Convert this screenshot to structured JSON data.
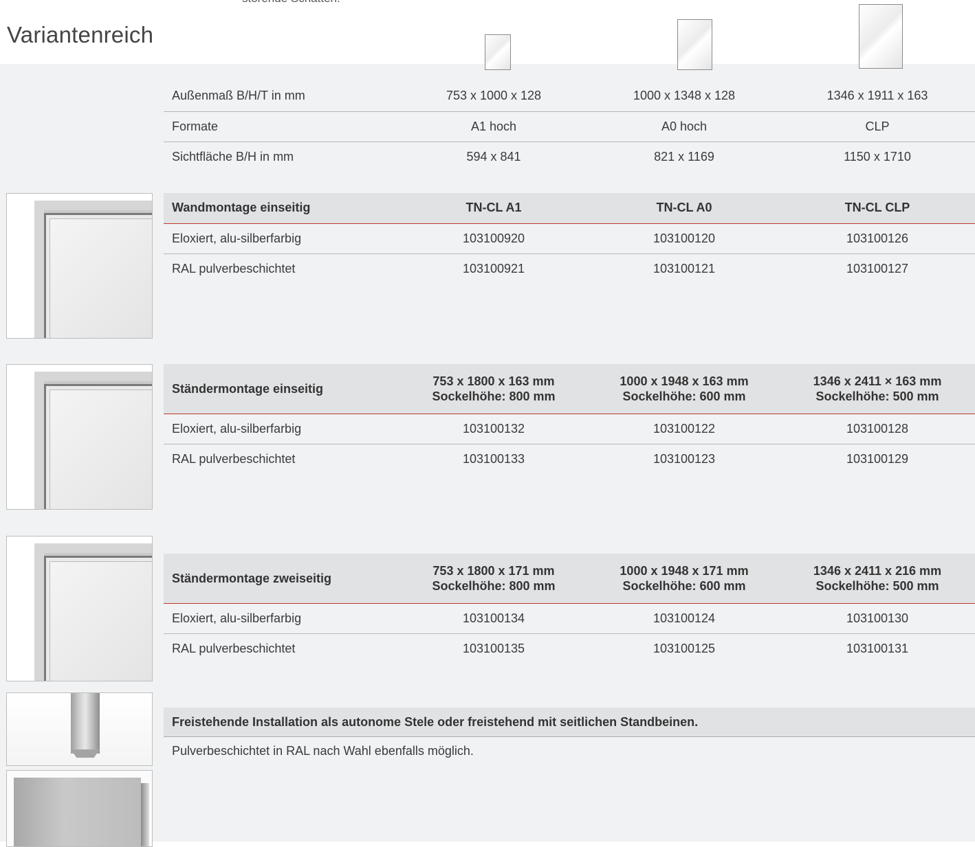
{
  "top_text": "störende Schatten.",
  "section_title": "Variantenreich",
  "specs": {
    "rows": [
      {
        "label": "Außenmaß B/H/T in mm",
        "values": [
          "753 x 1000 x 128",
          "1000 x 1348 x 128",
          "1346 x 1911 x 163"
        ]
      },
      {
        "label": "Formate",
        "values": [
          "A1 hoch",
          "A0 hoch",
          "CLP"
        ]
      },
      {
        "label": "Sichtfläche B/H in mm",
        "values": [
          "594 x 841",
          "821 x 1169",
          "1150 x 1710"
        ]
      }
    ]
  },
  "wand": {
    "header": {
      "label": "Wandmontage einseitig",
      "values": [
        "TN-CL A1",
        "TN-CL A0",
        "TN-CL CLP"
      ]
    },
    "rows": [
      {
        "label": "Eloxiert, alu-silberfarbig",
        "values": [
          "103100920",
          "103100120",
          "103100126"
        ]
      },
      {
        "label": "RAL pulverbeschichtet",
        "values": [
          "103100921",
          "103100121",
          "103100127"
        ]
      }
    ]
  },
  "staender1": {
    "header": {
      "label": "Ständermontage einseitig",
      "values": [
        {
          "line1": "753 x 1800 x 163 mm",
          "line2": "Sockelhöhe: 800 mm"
        },
        {
          "line1": "1000 x 1948 x 163 mm",
          "line2": "Sockelhöhe: 600 mm"
        },
        {
          "line1": "1346 x 2411 × 163 mm",
          "line2": "Sockelhöhe: 500 mm"
        }
      ]
    },
    "rows": [
      {
        "label": "Eloxiert, alu-silberfarbig",
        "values": [
          "103100132",
          "103100122",
          "103100128"
        ]
      },
      {
        "label": "RAL pulverbeschichtet",
        "values": [
          "103100133",
          "103100123",
          "103100129"
        ]
      }
    ]
  },
  "staender2": {
    "header": {
      "label": "Ständermontage zweiseitig",
      "values": [
        {
          "line1": "753 x 1800 x 171 mm",
          "line2": "Sockelhöhe: 800 mm"
        },
        {
          "line1": "1000 x 1948 x 171 mm",
          "line2": "Sockelhöhe: 600 mm"
        },
        {
          "line1": "1346 x 2411 x 216 mm",
          "line2": "Sockelhöhe: 500 mm"
        }
      ]
    },
    "rows": [
      {
        "label": "Eloxiert, alu-silberfarbig",
        "values": [
          "103100134",
          "103100124",
          "103100130"
        ]
      },
      {
        "label": "RAL pulverbeschichtet",
        "values": [
          "103100135",
          "103100125",
          "103100131"
        ]
      }
    ]
  },
  "note": {
    "header": "Freistehende Installation als autonome Stele oder freistehend mit seitlichen Standbeinen.",
    "text": "Pulverbeschichtet in RAL nach Wahl ebenfalls möglich."
  },
  "colors": {
    "accent_line": "#c0392b",
    "band": "#f1f2f4",
    "header_bg": "#e1e2e4"
  }
}
